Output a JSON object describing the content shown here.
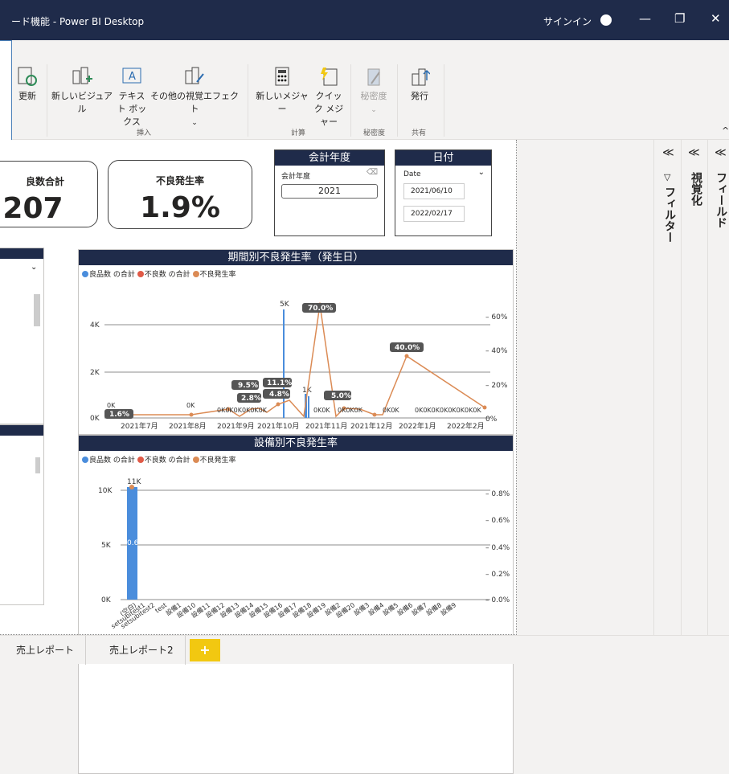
{
  "window": {
    "title": "ード機能 - Power BI Desktop",
    "signin": "サインイン",
    "min": "—",
    "restore": "❐",
    "close": "✕"
  },
  "ribbon": {
    "buttons": [
      {
        "label": "更新"
      },
      {
        "label": "新しいビジュアル"
      },
      {
        "label": "テキスト ボックス"
      },
      {
        "label": "その他の視覚エフェクト"
      },
      {
        "label": "新しいメジャー"
      },
      {
        "label": "クイック メジャー"
      },
      {
        "label": "秘密度"
      },
      {
        "label": "発行"
      }
    ],
    "groups": {
      "insert": "挿入",
      "calc": "計算",
      "sensitivity": "秘密度",
      "share": "共有"
    },
    "collapse": "^"
  },
  "cards": [
    {
      "label": "良数合計",
      "value": "207"
    },
    {
      "label": "不良発生率",
      "value": "1.9%"
    }
  ],
  "slicer_year": {
    "header": "会計年度",
    "label": "会計年度",
    "value": "2021"
  },
  "slicer_date": {
    "header": "日付",
    "label": "Date",
    "from": "2021/06/10",
    "to": "2022/02/17"
  },
  "chart1_title": "期間別不良発生率（発生日）",
  "chart2_title": "設備別不良発生率",
  "legend": {
    "a": "良品数 の合計",
    "b": "不良数 の合計",
    "c": "不良発生率"
  },
  "colors": {
    "good": "#4a8ddc",
    "bad": "#e05a47",
    "rate": "#db8b55",
    "header": "#1f2b4a"
  },
  "chart_data": [
    {
      "type": "bar",
      "title": "期間別不良発生率（発生日）",
      "x_ticks": [
        "2021年7月",
        "2021年8月",
        "2021年9月",
        "2021年10月",
        "2021年11月",
        "2021年12月",
        "2022年1月",
        "2022年2月"
      ],
      "y_left_ticks": [
        "0K",
        "2K",
        "4K"
      ],
      "y_right_ticks": [
        "0%",
        "20%",
        "40%",
        "60%"
      ],
      "series": [
        {
          "name": "不良発生率",
          "labels": [
            "1.6%",
            "9.5%",
            "2.8%",
            "11.1%",
            "4.8%",
            "70.0%",
            "5.0%",
            "40.0%"
          ]
        }
      ],
      "bar_labels": [
        "5K",
        "1K",
        "0K",
        "0K"
      ],
      "zero_label_runs": [
        "0K0K0K0K0K0K",
        "0K0K",
        "0K0K0K",
        "0K0K",
        "0K0K0K0K0K0K0K0K"
      ]
    },
    {
      "type": "bar",
      "title": "設備別不良発生率",
      "categories": [
        "(空白)",
        "setsubitest1",
        "setsubitest2",
        "test",
        "設備1",
        "設備10",
        "設備11",
        "設備12",
        "設備13",
        "設備14",
        "設備15",
        "設備16",
        "設備17",
        "設備18",
        "設備19",
        "設備2",
        "設備20",
        "設備3",
        "設備4",
        "設備5",
        "設備6",
        "設備7",
        "設備8",
        "設備9"
      ],
      "y_left_ticks": [
        "0K",
        "5K",
        "10K"
      ],
      "y_right_ticks": [
        "0.0%",
        "0.2%",
        "0.4%",
        "0.6%",
        "0.8%"
      ],
      "top_label": "11K",
      "inner_label": "0.6"
    }
  ],
  "panes": {
    "filter": "フィルター",
    "visual": "視覚化",
    "fields": "フィールド",
    "chev": "≪"
  },
  "tabs": [
    {
      "label": "売上レポート"
    },
    {
      "label": "売上レポート2"
    }
  ],
  "add_tab": "+"
}
